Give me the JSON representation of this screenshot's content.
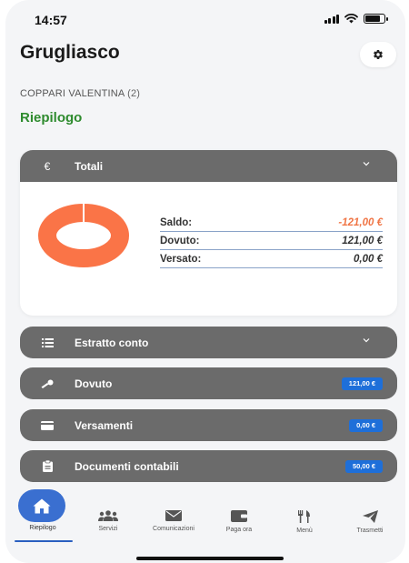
{
  "status": {
    "time": "14:57"
  },
  "header": {
    "title": "Grugliasco",
    "settings_icon": "gear-icon"
  },
  "user": {
    "name": "COPPARI VALENTINA",
    "count": "(2)"
  },
  "section": {
    "title": "Riepilogo"
  },
  "totali": {
    "icon": "euro-icon",
    "label": "Totali",
    "rows": [
      {
        "label": "Saldo:",
        "value": "-121,00 €"
      },
      {
        "label": "Dovuto:",
        "value": "121,00 €"
      },
      {
        "label": "Versato:",
        "value": "0,00 €"
      }
    ]
  },
  "sections": {
    "estratto": {
      "icon": "list-icon",
      "label": "Estratto conto"
    },
    "dovuto": {
      "icon": "key-icon",
      "label": "Dovuto",
      "badge": "121,00 €"
    },
    "versamenti": {
      "icon": "card-icon",
      "label": "Versamenti",
      "badge": "0,00 €"
    },
    "documenti": {
      "icon": "clipboard-icon",
      "label": "Documenti contabili",
      "badge": "50,00 €"
    }
  },
  "tabs": [
    {
      "label": "Riepilogo",
      "icon": "home-icon"
    },
    {
      "label": "Servizi",
      "icon": "users-icon"
    },
    {
      "label": "Comunicazioni",
      "icon": "envelope-icon"
    },
    {
      "label": "Paga ora",
      "icon": "wallet-icon"
    },
    {
      "label": "Menù",
      "icon": "utensils-icon"
    },
    {
      "label": "Trasmetti",
      "icon": "paper-plane-icon"
    }
  ],
  "colors": {
    "accent_blue": "#1e6fd9",
    "header_gray": "#6b6b6b",
    "donut_orange": "#fa7447",
    "negative": "#f07545",
    "green": "#2e8b2e"
  }
}
